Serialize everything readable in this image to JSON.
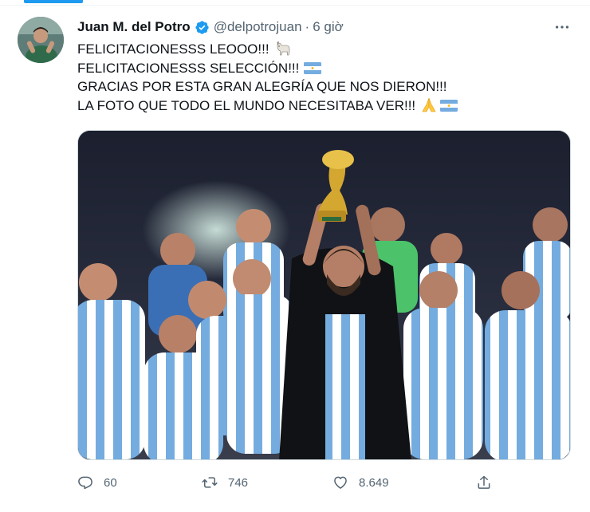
{
  "tweet": {
    "author": {
      "display_name": "Juan M. del Potro",
      "handle": "@delpotrojuan",
      "verified": true
    },
    "separator": "·",
    "timestamp": "6 giờ",
    "lines": [
      "FELICITACIONESSS LEOOO!!!",
      "FELICITACIONESSS SELECCIÓN!!!",
      "GRACIAS POR ESTA GRAN ALEGRÍA QUE NOS DIERON!!!",
      "LA FOTO QUE TODO EL MUNDO NECESITABA VER!!!"
    ],
    "emojis": {
      "line1": "goat-emoji",
      "line2": "argentina-flag-emoji",
      "line4": [
        "folded-hands-emoji",
        "argentina-flag-emoji"
      ]
    },
    "stats": {
      "replies": "60",
      "retweets": "746",
      "likes": "8.649"
    }
  },
  "colors": {
    "accent": "#1d9bf0",
    "text_primary": "#0f1419",
    "text_secondary": "#536471",
    "argentina_blue": "#74acdf"
  },
  "icons": [
    "verified-icon",
    "more-icon",
    "reply-icon",
    "retweet-icon",
    "like-icon",
    "share-icon"
  ]
}
